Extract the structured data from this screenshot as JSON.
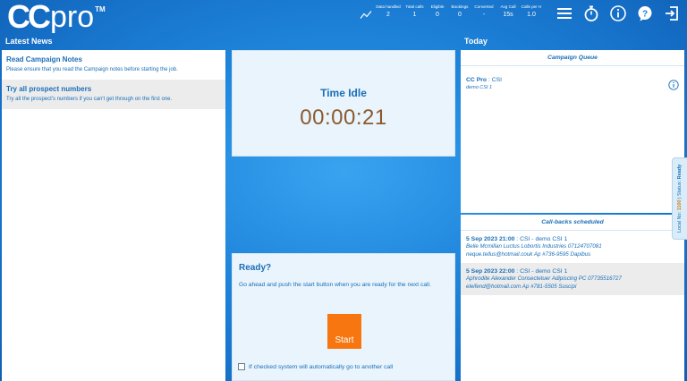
{
  "brand": {
    "logo_main": "CC",
    "logo_sub": "pro",
    "logo_tm": "TM"
  },
  "stats": [
    {
      "label": "Data handled",
      "value": "2"
    },
    {
      "label": "Total calls",
      "value": "1"
    },
    {
      "label": "Eligible",
      "value": "0"
    },
    {
      "label": "Bookings",
      "value": "0"
    },
    {
      "label": "Converted",
      "value": "-"
    },
    {
      "label": "Avg Call",
      "value": "15s"
    },
    {
      "label": "Calls per H",
      "value": "1.0"
    }
  ],
  "top_icons": [
    "menu-icon",
    "stopwatch-icon",
    "info-icon",
    "help-icon",
    "logout-icon"
  ],
  "headers": {
    "news": "Latest News",
    "today": "Today"
  },
  "news": [
    {
      "title": "Read Campaign Notes",
      "body": "Please ensure that you read the Campaign notes before starting the job."
    },
    {
      "title": "Try all prospect numbers",
      "body": "Try all the prospect's numbers if you can't get through on the first one."
    }
  ],
  "idle": {
    "title": "Time Idle",
    "time": "00:00:21"
  },
  "ready": {
    "title": "Ready?",
    "text": "Go ahead and push the start button when you are ready for the next call.",
    "start_label": "Start",
    "auto_label": "If checked system will automatically go to another call"
  },
  "queue": {
    "header": "Campaign Queue",
    "item": {
      "name_bold": "CC Pro",
      "name_rest": " : CSI",
      "sub": "demo CSI 1"
    }
  },
  "callbacks": {
    "header": "Call-backs scheduled",
    "items": [
      {
        "date": "5 Sep 2023 21:00",
        "campaign": " : CSI - demo CSI 1",
        "line2": "Belle Mcmillan Luctus Lobortis Industries 07124707081",
        "line3": "neque.tellus@hotmail.couk Ap #736-9595 Dapibus"
      },
      {
        "date": "5 Sep 2023 22:00",
        "campaign": " : CSI - demo CSI 1",
        "line2": "Aphrodite Alexander Consectetuer Adipiscing PC 07735516727",
        "line3": "eleifend@hotmail.com Ap #781-5505 Suscipi"
      }
    ]
  },
  "status_tab": {
    "local_label": "Local No: ",
    "extension": "1100",
    "sep": " | Status: ",
    "status": "Ready"
  },
  "colors": {
    "accent": "#1a6fb8",
    "start_button": "#f7760f",
    "timer": "#8a5a2e"
  }
}
